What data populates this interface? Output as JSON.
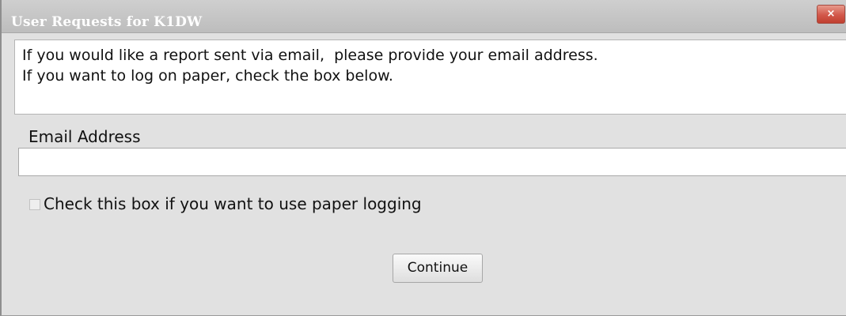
{
  "window": {
    "title": "User Requests for K1DW",
    "close_glyph": "×",
    "close_icon": "close-icon"
  },
  "info": {
    "line1": "If you would like a report sent via email,  please provide your email address.",
    "line2": "If you want to log on paper, check the box below."
  },
  "email": {
    "label": "Email Address",
    "value": "",
    "placeholder": ""
  },
  "paper_logging": {
    "label": "Check this box if you want to use paper logging",
    "checked": false
  },
  "buttons": {
    "continue_label": "Continue"
  },
  "colors": {
    "title_bar": "#c6c6c6",
    "close_button": "#d2574a",
    "dialog_background": "#e1e1e1",
    "panel_background": "#ffffff"
  }
}
